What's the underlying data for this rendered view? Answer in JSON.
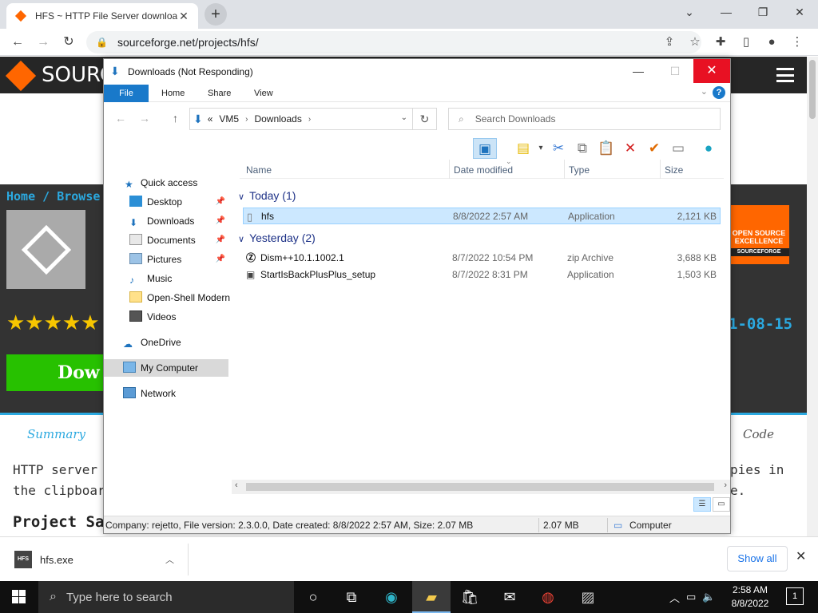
{
  "browser": {
    "tab_title": "HFS ~ HTTP File Server download",
    "url": "sourceforge.net/projects/hfs/",
    "new_tab": "+",
    "window_controls": {
      "minimize": "—",
      "maximize": "❐",
      "close": "✕"
    },
    "nav": {
      "back": "←",
      "forward": "→",
      "reload": "↻"
    },
    "right_icons": [
      "share-icon",
      "bookmark-star-icon",
      "extensions-icon",
      "sidebar-icon",
      "profile-icon",
      "menu-icon"
    ]
  },
  "sf_page": {
    "logo_text": "SOURC",
    "breadcrumb": "Home / Browse",
    "rating_stars": "★★★★★",
    "download_button": "Dow",
    "badge_text": "OPEN SOURCE EXCELLENCE",
    "badge_brand": "SOURCEFORGE",
    "date_partial": "1-08-15",
    "tab_summary": "Summary",
    "tab_code": "Code",
    "desc_line1": "HTTP server",
    "desc_line2": "the clipboard",
    "desc_line1_right": "pies in",
    "desc_line2_right": "e.",
    "section_heading": "Project Sa"
  },
  "explorer": {
    "title": "Downloads (Not Responding)",
    "ribbon_tabs": [
      "File",
      "Home",
      "Share",
      "View"
    ],
    "help": "?",
    "address": {
      "prefix": "«",
      "crumbs": [
        "VM5",
        "Downloads"
      ]
    },
    "search_placeholder": "Search Downloads",
    "nav": [
      {
        "label": "Quick access",
        "pinned": false
      },
      {
        "label": "Desktop",
        "pinned": true
      },
      {
        "label": "Downloads",
        "pinned": true
      },
      {
        "label": "Documents",
        "pinned": true
      },
      {
        "label": "Pictures",
        "pinned": true
      },
      {
        "label": "Music",
        "pinned": false
      },
      {
        "label": "Open-Shell Modern",
        "pinned": false
      },
      {
        "label": "Videos",
        "pinned": false
      },
      {
        "label": "OneDrive",
        "pinned": false
      },
      {
        "label": "My Computer",
        "pinned": false
      },
      {
        "label": "Network",
        "pinned": false
      }
    ],
    "columns": {
      "name": "Name",
      "date": "Date modified",
      "type": "Type",
      "size": "Size"
    },
    "groups": [
      {
        "label": "Today (1)"
      },
      {
        "label": "Yesterday (2)"
      }
    ],
    "files": [
      {
        "name": "hfs",
        "date": "8/8/2022 2:57 AM",
        "type": "Application",
        "size": "2,121 KB"
      },
      {
        "name": "Dism++10.1.1002.1",
        "date": "8/7/2022 10:54 PM",
        "type": "zip Archive",
        "size": "3,688 KB"
      },
      {
        "name": "StartIsBackPlusPlus_setup",
        "date": "8/7/2022 8:31 PM",
        "type": "Application",
        "size": "1,503 KB"
      }
    ],
    "status": {
      "details": "Company: rejetto, File version: 2.3.0.0, Date created: 8/8/2022 2:57 AM, Size: 2.07 MB",
      "size": "2.07 MB",
      "location": "Computer"
    }
  },
  "downloads_bar": {
    "file": "hfs.exe",
    "icon_text": "HFS",
    "show_all": "Show all"
  },
  "taskbar": {
    "search_placeholder": "Type here to search",
    "time": "2:58 AM",
    "date": "8/8/2022",
    "notifications": "1"
  }
}
